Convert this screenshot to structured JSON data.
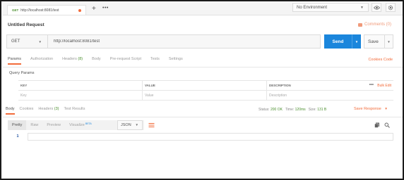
{
  "tab": {
    "method": "GET",
    "url": "http://localhost:8081/test"
  },
  "tabbar": {
    "plus": "+",
    "more": "•••"
  },
  "environment": {
    "label": "No Environment"
  },
  "icons": {
    "eye": "eye-icon",
    "settings": "gear-icon",
    "comments": "comment-icon",
    "copy": "copy-icon",
    "search": "search-icon",
    "wrap": "wrap-lines-icon"
  },
  "request": {
    "name": "Untitled Request",
    "comments_label": "Comments (0)",
    "method": "GET",
    "url": "http://localhost:8081/test",
    "send_label": "Send",
    "save_label": "Save"
  },
  "request_tabs": [
    {
      "label": "Params",
      "count": ""
    },
    {
      "label": "Authorization",
      "count": ""
    },
    {
      "label": "Headers",
      "count": "(8)"
    },
    {
      "label": "Body",
      "count": ""
    },
    {
      "label": "Pre-request Script",
      "count": ""
    },
    {
      "label": "Tests",
      "count": ""
    },
    {
      "label": "Settings",
      "count": ""
    }
  ],
  "cookies_code": "Cookies  Code",
  "query_params": {
    "title": "Query Params",
    "headers": [
      "KEY",
      "VALUE",
      "DESCRIPTION"
    ],
    "placeholders": [
      "Key",
      "Value",
      "Description"
    ],
    "more": "•••",
    "bulk_edit": "Bulk Edit"
  },
  "response_tabs": [
    {
      "label": "Body",
      "count": ""
    },
    {
      "label": "Cookies",
      "count": ""
    },
    {
      "label": "Headers",
      "count": "(3)"
    },
    {
      "label": "Test Results",
      "count": ""
    }
  ],
  "response_status": {
    "status_label": "Status:",
    "status_value": "200 OK",
    "time_label": "Time:",
    "time_value": "120ms",
    "size_label": "Size:",
    "size_value": "131 B"
  },
  "save_response": "Save Response",
  "viewer": {
    "modes": [
      "Pretty",
      "Raw",
      "Preview",
      "Visualize"
    ],
    "beta": "BETA",
    "format": "JSON"
  },
  "editor": {
    "line": "1"
  },
  "colors": {
    "accent": "#f26b3a",
    "send": "#1b86dc",
    "success": "#4b8f2e"
  }
}
